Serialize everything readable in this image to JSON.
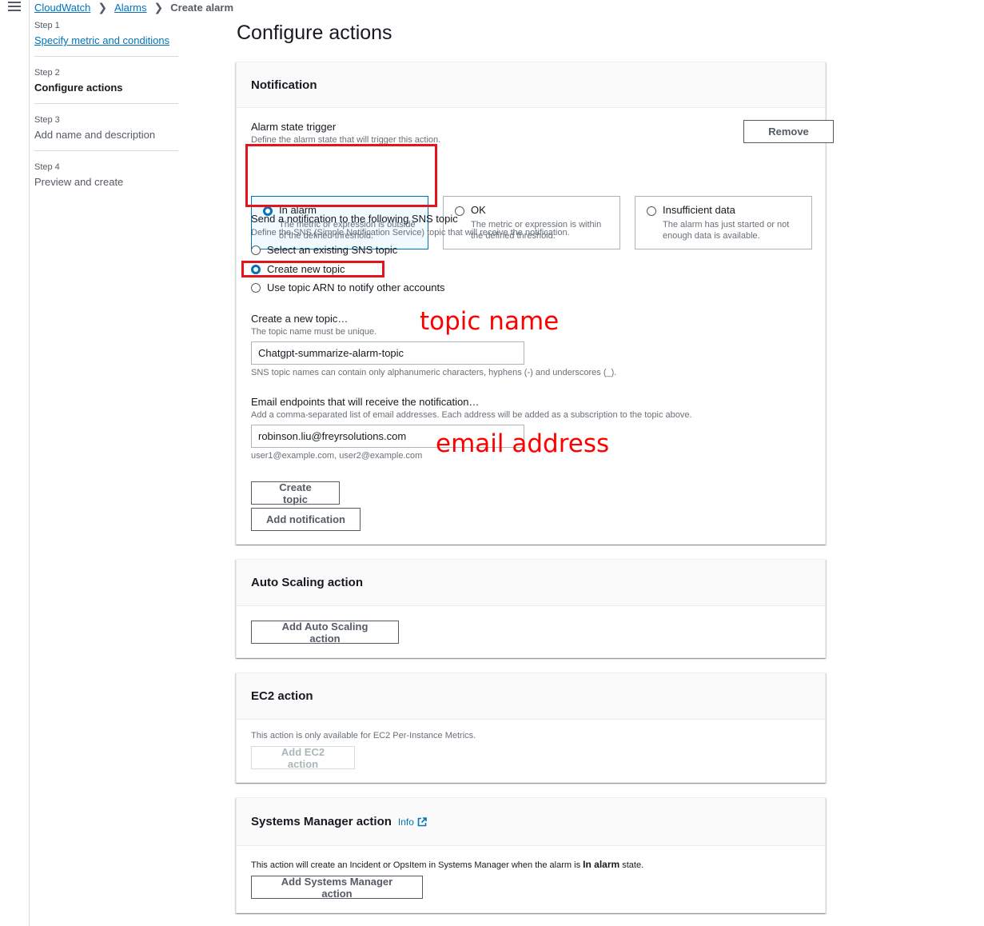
{
  "breadcrumb": {
    "items": [
      "CloudWatch",
      "Alarms"
    ],
    "current": "Create alarm"
  },
  "steps": [
    {
      "num": "Step 1",
      "title": "Specify metric and conditions"
    },
    {
      "num": "Step 2",
      "title": "Configure actions"
    },
    {
      "num": "Step 3",
      "title": "Add name and description"
    },
    {
      "num": "Step 4",
      "title": "Preview and create"
    }
  ],
  "page_title": "Configure actions",
  "notification": {
    "header": "Notification",
    "remove_label": "Remove",
    "trigger_label": "Alarm state trigger",
    "trigger_desc": "Define the alarm state that will trigger this action.",
    "tiles": [
      {
        "title": "In alarm",
        "desc": "The metric or expression is outside of the defined threshold."
      },
      {
        "title": "OK",
        "desc": "The metric or expression is within the defined threshold."
      },
      {
        "title": "Insufficient data",
        "desc": "The alarm has just started or not enough data is available."
      }
    ],
    "sns_label": "Send a notification to the following SNS topic",
    "sns_desc": "Define the SNS (Simple Notification Service) topic that will receive the notification.",
    "sns_options": [
      "Select an existing SNS topic",
      "Create new topic",
      "Use topic ARN to notify other accounts"
    ],
    "new_topic_label": "Create a new topic…",
    "new_topic_desc": "The topic name must be unique.",
    "topic_value": "Chatgpt-summarize-alarm-topic",
    "topic_hint": "SNS topic names can contain only alphanumeric characters, hyphens (-) and underscores (_).",
    "email_label": "Email endpoints that will receive the notification…",
    "email_desc": "Add a comma-separated list of email addresses. Each address will be added as a subscription to the topic above.",
    "email_value": "robinson.liu@freyrsolutions.com",
    "email_hint": "user1@example.com, user2@example.com",
    "create_topic_label": "Create topic",
    "add_notification_label": "Add notification"
  },
  "annotations": {
    "topic_name": "topic name",
    "email_address": "email address",
    "color": "#ff0000"
  },
  "autoscaling": {
    "header": "Auto Scaling action",
    "button": "Add Auto Scaling action"
  },
  "ec2": {
    "header": "EC2 action",
    "desc": "This action is only available for EC2 Per-Instance Metrics.",
    "button": "Add EC2 action"
  },
  "ssm": {
    "header": "Systems Manager action",
    "info": "Info",
    "desc_pre": "This action will create an Incident or OpsItem in Systems Manager when the alarm is",
    "desc_bold": "In alarm",
    "desc_post": "state.",
    "button": "Add Systems Manager action"
  },
  "colors": {
    "link": "#0073bb",
    "selected": "#0073bb",
    "highlight": "#e3141c"
  }
}
